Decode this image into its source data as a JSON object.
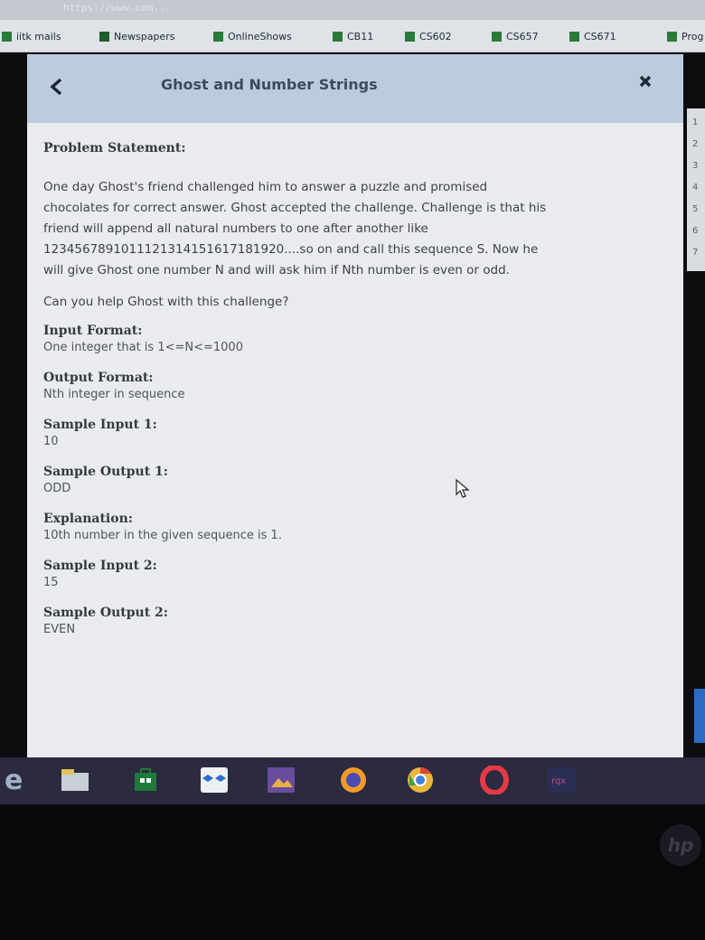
{
  "browser": {
    "address_text": "https://www.com...",
    "bookmarks": [
      {
        "label": "iitk mails"
      },
      {
        "label": "Newspapers"
      },
      {
        "label": "OnlineShows"
      },
      {
        "label": "CB11"
      },
      {
        "label": "CS602"
      },
      {
        "label": "CS657"
      },
      {
        "label": "CS671"
      },
      {
        "label": "Prog"
      }
    ]
  },
  "dialog": {
    "title": "Ghost and Number Strings",
    "back_icon": "chevron-left-icon",
    "close_icon": "close-icon"
  },
  "problem": {
    "statement_header": "Problem Statement:",
    "statement_lines": [
      "One day Ghost's friend challenged him to answer a puzzle and promised",
      "chocolates for correct answer. Ghost accepted the challenge. Challenge is that his",
      "friend will append all natural numbers to one after another like",
      "1234567891011121314151617181920....so on and call this sequence S. Now he",
      "will give Ghost one number N and will ask him if Nth number is even or odd."
    ],
    "question": "Can you help Ghost with this challenge?",
    "input_format_header": "Input Format:",
    "input_format": "One integer that is 1<=N<=1000",
    "output_format_header": "Output Format:",
    "output_format": "Nth integer in sequence",
    "sample_input_1_header": "Sample Input 1:",
    "sample_input_1": "10",
    "sample_output_1_header": "Sample Output 1:",
    "sample_output_1": "ODD",
    "explanation_header": "Explanation:",
    "explanation": "10th number in the given sequence is 1.",
    "sample_input_2_header": "Sample Input 2:",
    "sample_input_2": "15",
    "sample_output_2_header": "Sample Output 2:",
    "sample_output_2": "EVEN"
  },
  "gutter_numbers": [
    "1",
    "2",
    "3",
    "4",
    "5",
    "6",
    "7"
  ],
  "taskbar": {
    "items": [
      "edge-icon",
      "file-explorer-icon",
      "store-icon",
      "dropbox-icon",
      "photos-icon",
      "firefox-icon",
      "chrome-icon",
      "opera-icon",
      "app-icon"
    ],
    "app_label": "rqx"
  },
  "device": {
    "logo": "hp"
  },
  "colors": {
    "dialog_bg": "#e9ebee",
    "header_bg": "#bccbdd",
    "taskbar_bg": "#2b2a3e",
    "bookmark_icon": "#2a7a3a"
  }
}
